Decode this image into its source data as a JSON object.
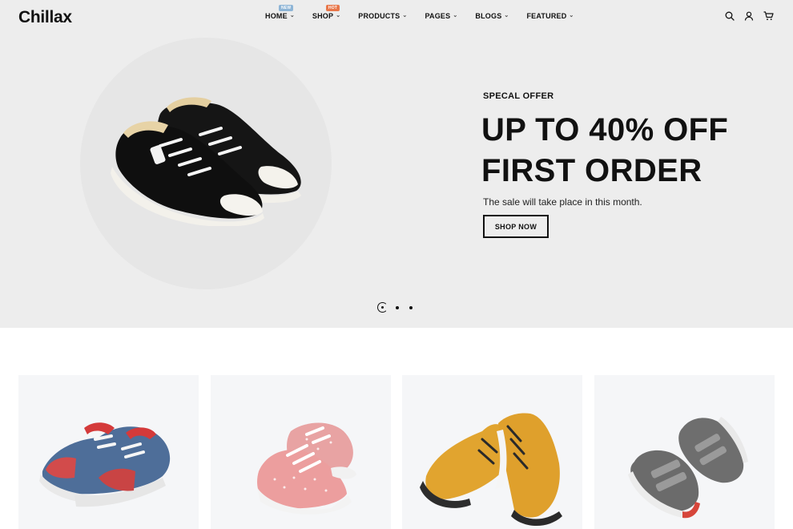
{
  "header": {
    "logo": "Chillax",
    "nav": [
      {
        "label": "HOME",
        "badge": "NEW"
      },
      {
        "label": "SHOP",
        "badge": "HOT"
      },
      {
        "label": "PRODUCTS"
      },
      {
        "label": "PAGES"
      },
      {
        "label": "BLOGS"
      },
      {
        "label": "FEATURED"
      }
    ],
    "icons": [
      "search-icon",
      "user-icon",
      "cart-icon"
    ]
  },
  "hero": {
    "offer_label": "SPECAL OFFER",
    "title_line1": "UP TO 40% OFF",
    "title_line2": "FIRST ORDER",
    "subtitle": "The sale will take place in this month.",
    "button": "SHOP NOW",
    "slides": 3,
    "active_slide": 1
  },
  "products": [
    {
      "image": "baby-denim-sneaker"
    },
    {
      "image": "pink-polka-dot-sneaker"
    },
    {
      "image": "yellow-leather-boots"
    },
    {
      "image": "gray-velcro-sneakers"
    }
  ],
  "colors": {
    "hero_bg": "#ededed",
    "card_bg": "#f5f6f8",
    "badge_new": "#8eb5d6",
    "badge_hot": "#e8774a",
    "text": "#111111"
  }
}
